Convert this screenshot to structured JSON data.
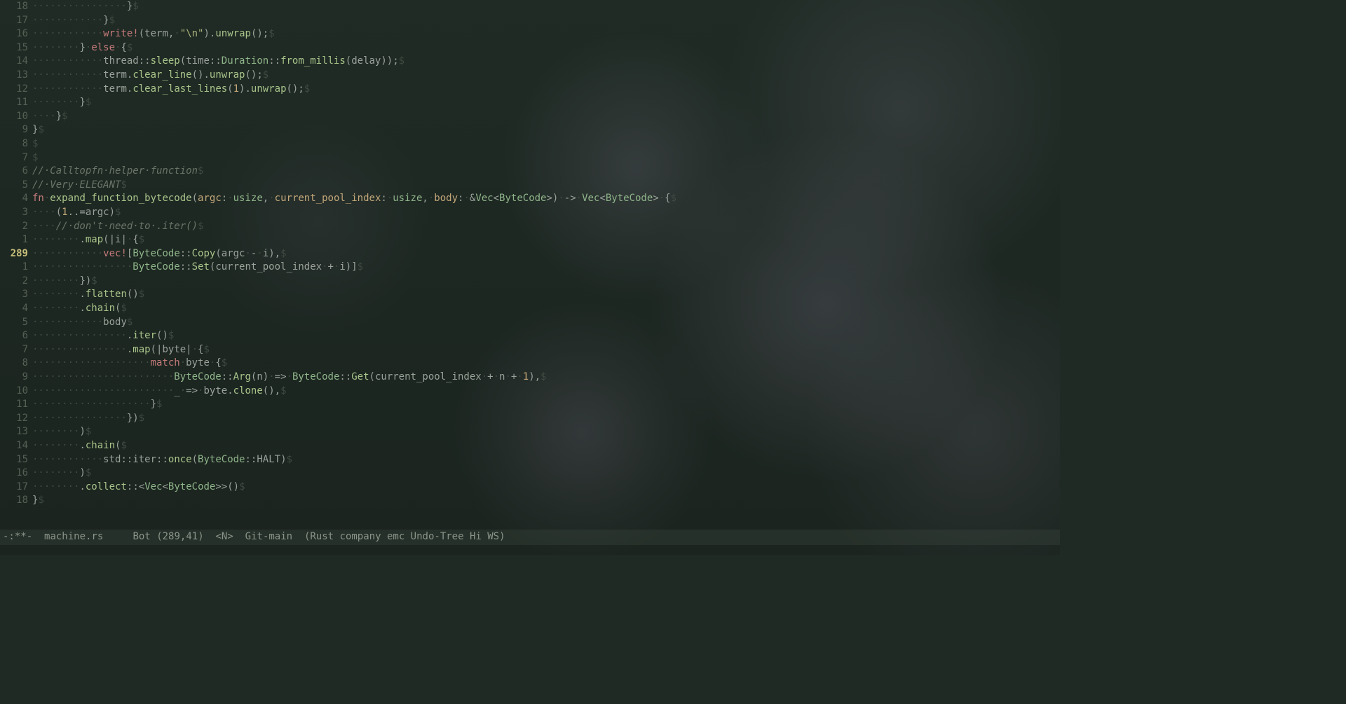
{
  "modeline": {
    "modified": "-:**-",
    "filename": "machine.rs",
    "position": "Bot",
    "cursor": "(289,41)",
    "mode_indicator": "<N>",
    "vcs": "Git-main",
    "minor_modes": "(Rust company emc Undo-Tree Hi WS)"
  },
  "cursor_line_number": "289",
  "lines": [
    {
      "rel": "18",
      "tokens": [
        {
          "c": "ws",
          "t": "················"
        },
        {
          "c": "pn",
          "t": "}"
        },
        {
          "c": "eol",
          "t": "$"
        }
      ]
    },
    {
      "rel": "17",
      "tokens": [
        {
          "c": "ws",
          "t": "············"
        },
        {
          "c": "pn",
          "t": "}"
        },
        {
          "c": "eol",
          "t": "$"
        }
      ]
    },
    {
      "rel": "16",
      "tokens": [
        {
          "c": "ws",
          "t": "············"
        },
        {
          "c": "macro",
          "t": "write!"
        },
        {
          "c": "pn",
          "t": "("
        },
        {
          "c": "id",
          "t": "term"
        },
        {
          "c": "pn",
          "t": ","
        },
        {
          "c": "ws",
          "t": "·"
        },
        {
          "c": "st",
          "t": "\"\\n\""
        },
        {
          "c": "pn",
          "t": ")"
        },
        {
          "c": "pn",
          "t": "."
        },
        {
          "c": "fn",
          "t": "unwrap"
        },
        {
          "c": "pn",
          "t": "();"
        },
        {
          "c": "eol",
          "t": "$"
        }
      ]
    },
    {
      "rel": "15",
      "tokens": [
        {
          "c": "ws",
          "t": "········"
        },
        {
          "c": "pn",
          "t": "}"
        },
        {
          "c": "ws",
          "t": "·"
        },
        {
          "c": "kw",
          "t": "else"
        },
        {
          "c": "ws",
          "t": "·"
        },
        {
          "c": "pn",
          "t": "{"
        },
        {
          "c": "eol",
          "t": "$"
        }
      ]
    },
    {
      "rel": "14",
      "tokens": [
        {
          "c": "ws",
          "t": "············"
        },
        {
          "c": "id",
          "t": "thread"
        },
        {
          "c": "pn",
          "t": "::"
        },
        {
          "c": "fn",
          "t": "sleep"
        },
        {
          "c": "pn",
          "t": "("
        },
        {
          "c": "id",
          "t": "time"
        },
        {
          "c": "pn",
          "t": "::"
        },
        {
          "c": "ty",
          "t": "Duration"
        },
        {
          "c": "pn",
          "t": "::"
        },
        {
          "c": "fn",
          "t": "from_millis"
        },
        {
          "c": "pn",
          "t": "("
        },
        {
          "c": "id",
          "t": "delay"
        },
        {
          "c": "pn",
          "t": "));"
        },
        {
          "c": "eol",
          "t": "$"
        }
      ]
    },
    {
      "rel": "13",
      "tokens": [
        {
          "c": "ws",
          "t": "············"
        },
        {
          "c": "id",
          "t": "term"
        },
        {
          "c": "pn",
          "t": "."
        },
        {
          "c": "fn",
          "t": "clear_line"
        },
        {
          "c": "pn",
          "t": "()"
        },
        {
          "c": "pn",
          "t": "."
        },
        {
          "c": "fn",
          "t": "unwrap"
        },
        {
          "c": "pn",
          "t": "();"
        },
        {
          "c": "eol",
          "t": "$"
        }
      ]
    },
    {
      "rel": "12",
      "tokens": [
        {
          "c": "ws",
          "t": "············"
        },
        {
          "c": "id",
          "t": "term"
        },
        {
          "c": "pn",
          "t": "."
        },
        {
          "c": "fn",
          "t": "clear_last_lines"
        },
        {
          "c": "pn",
          "t": "("
        },
        {
          "c": "nm",
          "t": "1"
        },
        {
          "c": "pn",
          "t": ")"
        },
        {
          "c": "pn",
          "t": "."
        },
        {
          "c": "fn",
          "t": "unwrap"
        },
        {
          "c": "pn",
          "t": "();"
        },
        {
          "c": "eol",
          "t": "$"
        }
      ]
    },
    {
      "rel": "11",
      "tokens": [
        {
          "c": "ws",
          "t": "········"
        },
        {
          "c": "pn",
          "t": "}"
        },
        {
          "c": "eol",
          "t": "$"
        }
      ]
    },
    {
      "rel": "10",
      "tokens": [
        {
          "c": "ws",
          "t": "····"
        },
        {
          "c": "pn",
          "t": "}"
        },
        {
          "c": "eol",
          "t": "$"
        }
      ]
    },
    {
      "rel": "9",
      "tokens": [
        {
          "c": "pn",
          "t": "}"
        },
        {
          "c": "eol",
          "t": "$"
        }
      ]
    },
    {
      "rel": "8",
      "tokens": [
        {
          "c": "eol",
          "t": "$"
        }
      ]
    },
    {
      "rel": "7",
      "tokens": [
        {
          "c": "eol",
          "t": "$"
        }
      ]
    },
    {
      "rel": "6",
      "tokens": [
        {
          "c": "cm",
          "t": "//·Calltopfn·helper·function"
        },
        {
          "c": "eol",
          "t": "$"
        }
      ]
    },
    {
      "rel": "5",
      "tokens": [
        {
          "c": "cm",
          "t": "//·Very·ELEGANT"
        },
        {
          "c": "eol",
          "t": "$"
        }
      ]
    },
    {
      "rel": "4",
      "tokens": [
        {
          "c": "kw",
          "t": "fn"
        },
        {
          "c": "ws",
          "t": "·"
        },
        {
          "c": "fn",
          "t": "expand_function_bytecode"
        },
        {
          "c": "pn",
          "t": "("
        },
        {
          "c": "param",
          "t": "argc"
        },
        {
          "c": "pn",
          "t": ":"
        },
        {
          "c": "ws",
          "t": "·"
        },
        {
          "c": "ty",
          "t": "usize"
        },
        {
          "c": "pn",
          "t": ","
        },
        {
          "c": "ws",
          "t": "·"
        },
        {
          "c": "param",
          "t": "current_pool_index"
        },
        {
          "c": "pn",
          "t": ":"
        },
        {
          "c": "ws",
          "t": "·"
        },
        {
          "c": "ty",
          "t": "usize"
        },
        {
          "c": "pn",
          "t": ","
        },
        {
          "c": "ws",
          "t": "·"
        },
        {
          "c": "param",
          "t": "body"
        },
        {
          "c": "pn",
          "t": ":"
        },
        {
          "c": "ws",
          "t": "·"
        },
        {
          "c": "pn",
          "t": "&"
        },
        {
          "c": "ty",
          "t": "Vec"
        },
        {
          "c": "pn",
          "t": "<"
        },
        {
          "c": "ty",
          "t": "ByteCode"
        },
        {
          "c": "pn",
          "t": ">)"
        },
        {
          "c": "ws",
          "t": "·"
        },
        {
          "c": "pn",
          "t": "->"
        },
        {
          "c": "ws",
          "t": "·"
        },
        {
          "c": "ty",
          "t": "Vec"
        },
        {
          "c": "pn",
          "t": "<"
        },
        {
          "c": "ty",
          "t": "ByteCode"
        },
        {
          "c": "pn",
          "t": ">"
        },
        {
          "c": "ws",
          "t": "·"
        },
        {
          "c": "pn",
          "t": "{"
        },
        {
          "c": "eol",
          "t": "$"
        }
      ]
    },
    {
      "rel": "3",
      "tokens": [
        {
          "c": "ws",
          "t": "····"
        },
        {
          "c": "pn",
          "t": "("
        },
        {
          "c": "nm",
          "t": "1"
        },
        {
          "c": "pn",
          "t": "..="
        },
        {
          "c": "id",
          "t": "argc"
        },
        {
          "c": "pn",
          "t": ")"
        },
        {
          "c": "eol",
          "t": "$"
        }
      ]
    },
    {
      "rel": "2",
      "tokens": [
        {
          "c": "ws",
          "t": "····"
        },
        {
          "c": "cm",
          "t": "//·don't·need·to·.iter()"
        },
        {
          "c": "eol",
          "t": "$"
        }
      ]
    },
    {
      "rel": "1",
      "tokens": [
        {
          "c": "ws",
          "t": "········"
        },
        {
          "c": "pn",
          "t": "."
        },
        {
          "c": "fn",
          "t": "map"
        },
        {
          "c": "pn",
          "t": "(|"
        },
        {
          "c": "id",
          "t": "i"
        },
        {
          "c": "pn",
          "t": "|"
        },
        {
          "c": "ws",
          "t": "·"
        },
        {
          "c": "pn",
          "t": "{"
        },
        {
          "c": "eol",
          "t": "$"
        }
      ]
    },
    {
      "rel": "289",
      "current": true,
      "tokens": [
        {
          "c": "ws",
          "t": "············"
        },
        {
          "c": "macro",
          "t": "vec!"
        },
        {
          "c": "pn",
          "t": "["
        },
        {
          "c": "ty",
          "t": "ByteCode"
        },
        {
          "c": "pn",
          "t": "::"
        },
        {
          "c": "fn",
          "t": "Copy"
        },
        {
          "c": "pn",
          "t": "("
        },
        {
          "c": "id",
          "t": "argc"
        },
        {
          "c": "ws",
          "t": "·"
        },
        {
          "c": "pn",
          "t": "-"
        },
        {
          "c": "ws",
          "t": "·"
        },
        {
          "c": "id",
          "t": "i"
        },
        {
          "c": "pn",
          "t": "),"
        },
        {
          "c": "eol",
          "t": "$"
        }
      ]
    },
    {
      "rel": "1",
      "tokens": [
        {
          "c": "ws",
          "t": "·················"
        },
        {
          "c": "ty",
          "t": "ByteCode"
        },
        {
          "c": "pn",
          "t": "::"
        },
        {
          "c": "fn",
          "t": "Set"
        },
        {
          "c": "pn",
          "t": "("
        },
        {
          "c": "id",
          "t": "current_pool_index"
        },
        {
          "c": "ws",
          "t": "·"
        },
        {
          "c": "pn",
          "t": "+"
        },
        {
          "c": "ws",
          "t": "·"
        },
        {
          "c": "id",
          "t": "i"
        },
        {
          "c": "pn",
          "t": ")]"
        },
        {
          "c": "eol",
          "t": "$"
        }
      ]
    },
    {
      "rel": "2",
      "tokens": [
        {
          "c": "ws",
          "t": "········"
        },
        {
          "c": "pn",
          "t": "})"
        },
        {
          "c": "eol",
          "t": "$"
        }
      ]
    },
    {
      "rel": "3",
      "tokens": [
        {
          "c": "ws",
          "t": "········"
        },
        {
          "c": "pn",
          "t": "."
        },
        {
          "c": "fn",
          "t": "flatten"
        },
        {
          "c": "pn",
          "t": "()"
        },
        {
          "c": "eol",
          "t": "$"
        }
      ]
    },
    {
      "rel": "4",
      "tokens": [
        {
          "c": "ws",
          "t": "········"
        },
        {
          "c": "pn",
          "t": "."
        },
        {
          "c": "fn",
          "t": "chain"
        },
        {
          "c": "pn",
          "t": "("
        },
        {
          "c": "eol",
          "t": "$"
        }
      ]
    },
    {
      "rel": "5",
      "tokens": [
        {
          "c": "ws",
          "t": "············"
        },
        {
          "c": "id",
          "t": "body"
        },
        {
          "c": "eol",
          "t": "$"
        }
      ]
    },
    {
      "rel": "6",
      "tokens": [
        {
          "c": "ws",
          "t": "················"
        },
        {
          "c": "pn",
          "t": "."
        },
        {
          "c": "fn",
          "t": "iter"
        },
        {
          "c": "pn",
          "t": "()"
        },
        {
          "c": "eol",
          "t": "$"
        }
      ]
    },
    {
      "rel": "7",
      "tokens": [
        {
          "c": "ws",
          "t": "················"
        },
        {
          "c": "pn",
          "t": "."
        },
        {
          "c": "fn",
          "t": "map"
        },
        {
          "c": "pn",
          "t": "(|"
        },
        {
          "c": "id",
          "t": "byte"
        },
        {
          "c": "pn",
          "t": "|"
        },
        {
          "c": "ws",
          "t": "·"
        },
        {
          "c": "pn",
          "t": "{"
        },
        {
          "c": "eol",
          "t": "$"
        }
      ]
    },
    {
      "rel": "8",
      "tokens": [
        {
          "c": "ws",
          "t": "····················"
        },
        {
          "c": "kw",
          "t": "match"
        },
        {
          "c": "ws",
          "t": "·"
        },
        {
          "c": "id",
          "t": "byte"
        },
        {
          "c": "ws",
          "t": "·"
        },
        {
          "c": "pn",
          "t": "{"
        },
        {
          "c": "eol",
          "t": "$"
        }
      ]
    },
    {
      "rel": "9",
      "tokens": [
        {
          "c": "ws",
          "t": "························"
        },
        {
          "c": "ty",
          "t": "ByteCode"
        },
        {
          "c": "pn",
          "t": "::"
        },
        {
          "c": "fn",
          "t": "Arg"
        },
        {
          "c": "pn",
          "t": "("
        },
        {
          "c": "id",
          "t": "n"
        },
        {
          "c": "pn",
          "t": ")"
        },
        {
          "c": "ws",
          "t": "·"
        },
        {
          "c": "pn",
          "t": "=>"
        },
        {
          "c": "ws",
          "t": "·"
        },
        {
          "c": "ty",
          "t": "ByteCode"
        },
        {
          "c": "pn",
          "t": "::"
        },
        {
          "c": "fn",
          "t": "Get"
        },
        {
          "c": "pn",
          "t": "("
        },
        {
          "c": "id",
          "t": "current_pool_index"
        },
        {
          "c": "ws",
          "t": "·"
        },
        {
          "c": "pn",
          "t": "+"
        },
        {
          "c": "ws",
          "t": "·"
        },
        {
          "c": "id",
          "t": "n"
        },
        {
          "c": "ws",
          "t": "·"
        },
        {
          "c": "pn",
          "t": "+"
        },
        {
          "c": "ws",
          "t": "·"
        },
        {
          "c": "nm",
          "t": "1"
        },
        {
          "c": "pn",
          "t": "),"
        },
        {
          "c": "eol",
          "t": "$"
        }
      ]
    },
    {
      "rel": "10",
      "tokens": [
        {
          "c": "ws",
          "t": "························"
        },
        {
          "c": "pn",
          "t": "_"
        },
        {
          "c": "ws",
          "t": "·"
        },
        {
          "c": "pn",
          "t": "=>"
        },
        {
          "c": "ws",
          "t": "·"
        },
        {
          "c": "id",
          "t": "byte"
        },
        {
          "c": "pn",
          "t": "."
        },
        {
          "c": "fn",
          "t": "clone"
        },
        {
          "c": "pn",
          "t": "(),"
        },
        {
          "c": "eol",
          "t": "$"
        }
      ]
    },
    {
      "rel": "11",
      "tokens": [
        {
          "c": "ws",
          "t": "····················"
        },
        {
          "c": "pn",
          "t": "}"
        },
        {
          "c": "eol",
          "t": "$"
        }
      ]
    },
    {
      "rel": "12",
      "tokens": [
        {
          "c": "ws",
          "t": "················"
        },
        {
          "c": "pn",
          "t": "})"
        },
        {
          "c": "eol",
          "t": "$"
        }
      ]
    },
    {
      "rel": "13",
      "tokens": [
        {
          "c": "ws",
          "t": "········"
        },
        {
          "c": "pn",
          "t": ")"
        },
        {
          "c": "eol",
          "t": "$"
        }
      ]
    },
    {
      "rel": "14",
      "tokens": [
        {
          "c": "ws",
          "t": "········"
        },
        {
          "c": "pn",
          "t": "."
        },
        {
          "c": "fn",
          "t": "chain"
        },
        {
          "c": "pn",
          "t": "("
        },
        {
          "c": "eol",
          "t": "$"
        }
      ]
    },
    {
      "rel": "15",
      "tokens": [
        {
          "c": "ws",
          "t": "············"
        },
        {
          "c": "id",
          "t": "std"
        },
        {
          "c": "pn",
          "t": "::"
        },
        {
          "c": "id",
          "t": "iter"
        },
        {
          "c": "pn",
          "t": "::"
        },
        {
          "c": "fn",
          "t": "once"
        },
        {
          "c": "pn",
          "t": "("
        },
        {
          "c": "ty",
          "t": "ByteCode"
        },
        {
          "c": "pn",
          "t": "::"
        },
        {
          "c": "id",
          "t": "HALT"
        },
        {
          "c": "pn",
          "t": ")"
        },
        {
          "c": "eol",
          "t": "$"
        }
      ]
    },
    {
      "rel": "16",
      "tokens": [
        {
          "c": "ws",
          "t": "········"
        },
        {
          "c": "pn",
          "t": ")"
        },
        {
          "c": "eol",
          "t": "$"
        }
      ]
    },
    {
      "rel": "17",
      "tokens": [
        {
          "c": "ws",
          "t": "········"
        },
        {
          "c": "pn",
          "t": "."
        },
        {
          "c": "fn",
          "t": "collect"
        },
        {
          "c": "pn",
          "t": "::<"
        },
        {
          "c": "ty",
          "t": "Vec"
        },
        {
          "c": "pn",
          "t": "<"
        },
        {
          "c": "ty",
          "t": "ByteCode"
        },
        {
          "c": "pn",
          "t": ">>()"
        },
        {
          "c": "eol",
          "t": "$"
        }
      ]
    },
    {
      "rel": "18",
      "tokens": [
        {
          "c": "pn",
          "t": "}"
        },
        {
          "c": "eol",
          "t": "$"
        }
      ]
    }
  ]
}
